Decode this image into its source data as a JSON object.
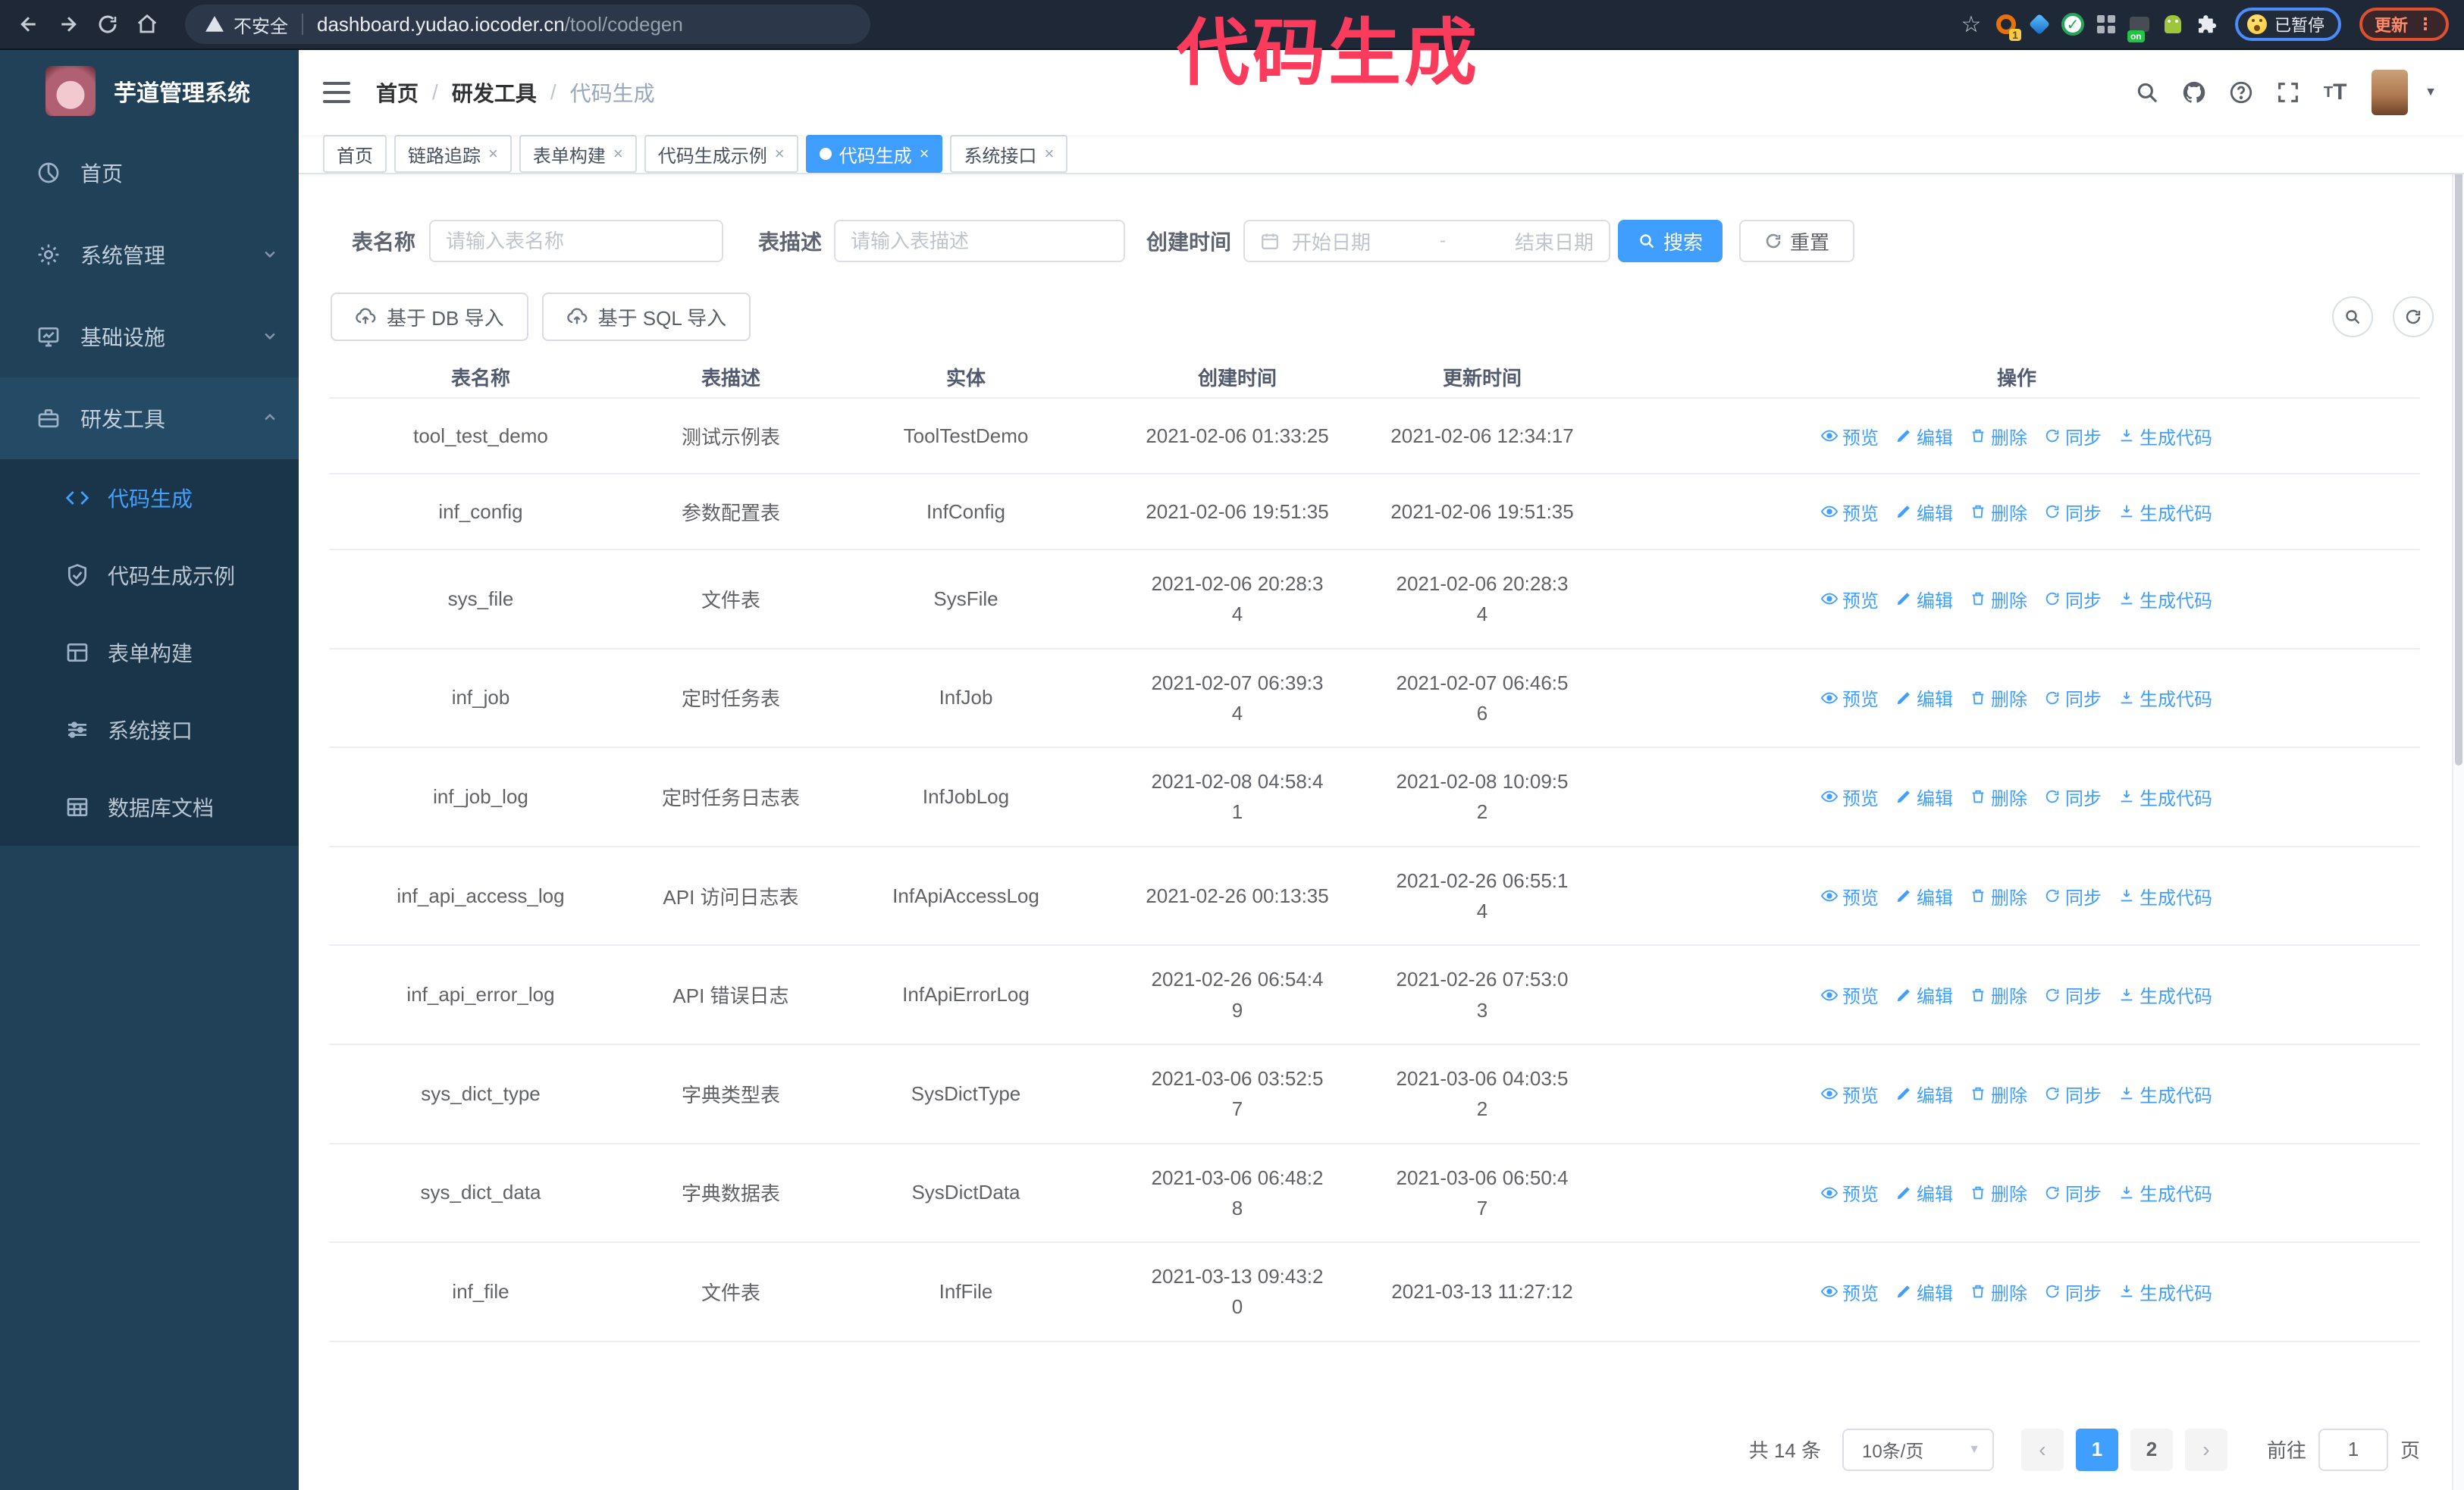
{
  "annotation": {
    "text": "代码生成",
    "color": "#fb3b5c"
  },
  "browser": {
    "security_label": "不安全",
    "url_host": "dashboard.yudao.iocoder.cn",
    "url_path": "/tool/codegen",
    "extension_badge_1": "1",
    "extension_badge_on": "on",
    "paused_badge": "已暂停",
    "update_button": "更新"
  },
  "sidebar": {
    "title": "芋道管理系统",
    "items": [
      {
        "label": "首页"
      },
      {
        "label": "系统管理"
      },
      {
        "label": "基础设施"
      },
      {
        "label": "研发工具"
      }
    ],
    "sub_items": [
      {
        "label": "代码生成"
      },
      {
        "label": "代码生成示例"
      },
      {
        "label": "表单构建"
      },
      {
        "label": "系统接口"
      },
      {
        "label": "数据库文档"
      }
    ]
  },
  "header": {
    "breadcrumb": [
      "首页",
      "研发工具",
      "代码生成"
    ],
    "separator": "/"
  },
  "tabs": [
    {
      "label": "首页"
    },
    {
      "label": "链路追踪"
    },
    {
      "label": "表单构建"
    },
    {
      "label": "代码生成示例"
    },
    {
      "label": "代码生成"
    },
    {
      "label": "系统接口"
    }
  ],
  "filters": {
    "name_label": "表名称",
    "name_placeholder": "请输入表名称",
    "desc_label": "表描述",
    "desc_placeholder": "请输入表描述",
    "date_label": "创建时间",
    "date_start_placeholder": "开始日期",
    "date_separator": "-",
    "date_end_placeholder": "结束日期",
    "search_label": "搜索",
    "reset_label": "重置"
  },
  "toolbar": {
    "import_db_label": "基于 DB 导入",
    "import_sql_label": "基于 SQL 导入"
  },
  "table": {
    "headers": [
      "表名称",
      "表描述",
      "实体",
      "创建时间",
      "更新时间",
      "操作"
    ],
    "ops": [
      "预览",
      "编辑",
      "删除",
      "同步",
      "生成代码"
    ],
    "rows": [
      {
        "name": "tool_test_demo",
        "desc": "测试示例表",
        "entity": "ToolTestDemo",
        "created": "2021-02-06 01:33:25",
        "updated": "2021-02-06 12:34:17"
      },
      {
        "name": "inf_config",
        "desc": "参数配置表",
        "entity": "InfConfig",
        "created": "2021-02-06 19:51:35",
        "updated": "2021-02-06 19:51:35"
      },
      {
        "name": "sys_file",
        "desc": "文件表",
        "entity": "SysFile",
        "created": "2021-02-06 20:28:3\n4",
        "updated": "2021-02-06 20:28:3\n4"
      },
      {
        "name": "inf_job",
        "desc": "定时任务表",
        "entity": "InfJob",
        "created": "2021-02-07 06:39:3\n4",
        "updated": "2021-02-07 06:46:5\n6"
      },
      {
        "name": "inf_job_log",
        "desc": "定时任务日志表",
        "entity": "InfJobLog",
        "created": "2021-02-08 04:58:4\n1",
        "updated": "2021-02-08 10:09:5\n2"
      },
      {
        "name": "inf_api_access_log",
        "desc": "API 访问日志表",
        "entity": "InfApiAccessLog",
        "created": "2021-02-26 00:13:35",
        "updated": "2021-02-26 06:55:1\n4"
      },
      {
        "name": "inf_api_error_log",
        "desc": "API 错误日志",
        "entity": "InfApiErrorLog",
        "created": "2021-02-26 06:54:4\n9",
        "updated": "2021-02-26 07:53:0\n3"
      },
      {
        "name": "sys_dict_type",
        "desc": "字典类型表",
        "entity": "SysDictType",
        "created": "2021-03-06 03:52:5\n7",
        "updated": "2021-03-06 04:03:5\n2"
      },
      {
        "name": "sys_dict_data",
        "desc": "字典数据表",
        "entity": "SysDictData",
        "created": "2021-03-06 06:48:2\n8",
        "updated": "2021-03-06 06:50:4\n7"
      },
      {
        "name": "inf_file",
        "desc": "文件表",
        "entity": "InfFile",
        "created": "2021-03-13 09:43:2\n0",
        "updated": "2021-03-13 11:27:12"
      }
    ]
  },
  "pagination": {
    "total": "共 14 条",
    "page_size": "10条/页",
    "pages": [
      "1",
      "2"
    ],
    "goto_label": "前往",
    "goto_value": "1",
    "page_suffix": "页"
  },
  "colors": {
    "accent": "#409eff",
    "sidebar_bg": "#214159",
    "submenu_bg": "#1a3549",
    "annotation": "#fb3b5c",
    "browser_bar": "#1e2836"
  }
}
